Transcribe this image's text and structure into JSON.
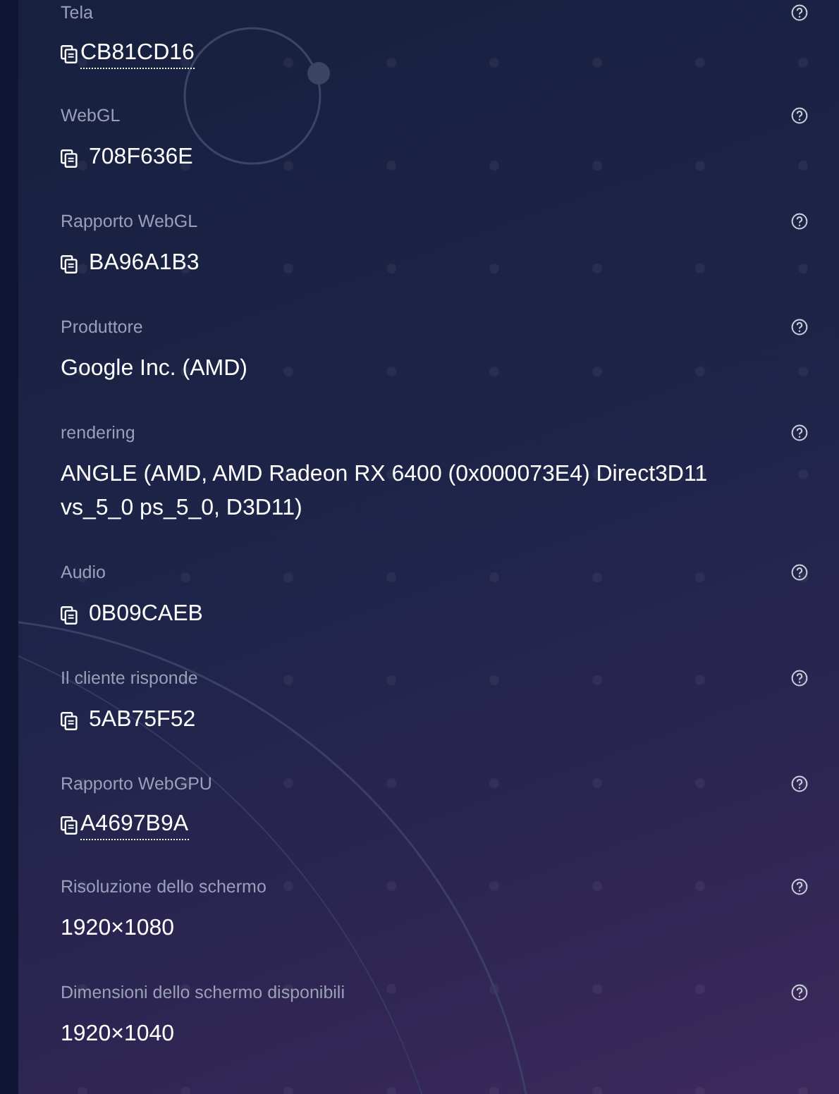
{
  "fields": [
    {
      "label": "Tela",
      "value": "CB81CD16",
      "kind": "copy-link"
    },
    {
      "label": "WebGL",
      "value": "708F636E",
      "kind": "copy"
    },
    {
      "label": "Rapporto WebGL",
      "value": "BA96A1B3",
      "kind": "copy"
    },
    {
      "label": "Produttore",
      "value": "Google Inc. (AMD)",
      "kind": "plain"
    },
    {
      "label": "rendering",
      "value": "ANGLE (AMD, AMD Radeon RX 6400 (0x000073E4) Direct3D11 vs_5_0 ps_5_0, D3D11)",
      "kind": "plain"
    },
    {
      "label": "Audio",
      "value": "0B09CAEB",
      "kind": "copy"
    },
    {
      "label": "Il cliente risponde",
      "value": "5AB75F52",
      "kind": "copy"
    },
    {
      "label": "Rapporto WebGPU",
      "value": "A4697B9A",
      "kind": "copy-link"
    },
    {
      "label": "Risoluzione dello schermo",
      "value": "1920×1080",
      "kind": "plain"
    },
    {
      "label": "Dimensioni dello schermo disponibili",
      "value": "1920×1040",
      "kind": "plain"
    }
  ]
}
